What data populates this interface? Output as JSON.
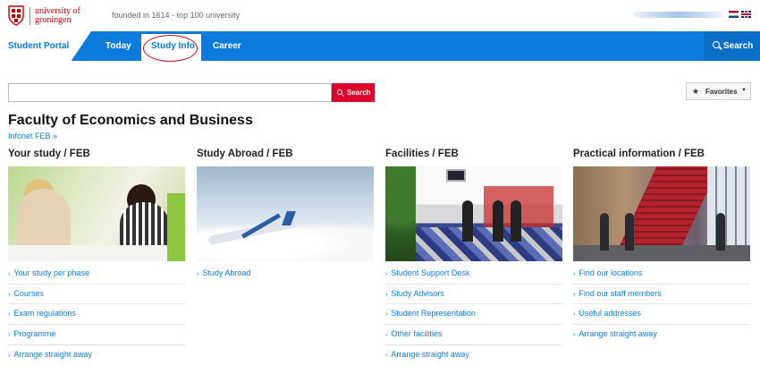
{
  "header": {
    "logo_line1": "university of",
    "logo_line2": "groningen",
    "tagline": "founded in 1614  -  top 100 university",
    "language_nl": "Dutch",
    "language_en": "English"
  },
  "nav": {
    "portal_label": "Student Portal",
    "items": [
      {
        "label": "Today"
      },
      {
        "label": "Study Info"
      },
      {
        "label": "Career"
      }
    ],
    "search_label": "Search"
  },
  "search": {
    "placeholder": "",
    "button_label": "Search"
  },
  "favorites": {
    "label": "Favorites"
  },
  "page": {
    "title": "Faculty of Economics and Business",
    "infonet_link": "Infonet FEB »"
  },
  "columns": [
    {
      "title": "Your study / FEB",
      "links": [
        "Your study per phase",
        "Courses",
        "Exam regulations",
        "Programme",
        "Arrange straight away"
      ]
    },
    {
      "title": "Study Abroad / FEB",
      "links": [
        "Study Abroad"
      ]
    },
    {
      "title": "Facilities / FEB",
      "links": [
        "Student Support Desk",
        "Study Advisors",
        "Student Representation",
        "Other facilities",
        "Arrange straight away"
      ]
    },
    {
      "title": "Practical information / FEB",
      "links": [
        "Find our locations",
        "Find our staff members",
        "Useful addresses",
        "Arrange straight away"
      ]
    }
  ],
  "colors": {
    "brand_blue": "#0c7bdc",
    "brand_red": "#dc002d",
    "annotation_red": "#c0151b"
  },
  "icons": {
    "crest": "university-crest-icon",
    "nav_search": "search-icon",
    "search_button": "search-icon",
    "favorites": "star-icon",
    "favorites_caret": "caret-down-icon",
    "link_bullet": "chevron-right-icon"
  }
}
